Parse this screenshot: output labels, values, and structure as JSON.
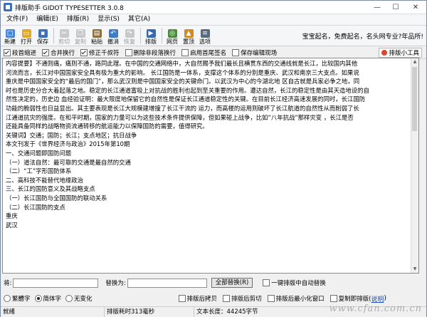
{
  "window": {
    "title": "排版助手 GIDOT TYPESETTER 3.0.8"
  },
  "menu": [
    "文件(F)",
    "编辑(E)",
    "排版(R)",
    "显示(S)",
    "其它(A)"
  ],
  "toolbar": {
    "tools": [
      {
        "label": "新建",
        "icon": "new-file-icon",
        "color": "#4a86d8",
        "glyph": "□",
        "disabled": false
      },
      {
        "label": "打开",
        "icon": "open-folder-icon",
        "color": "#e0a92b",
        "glyph": "▭",
        "disabled": false
      },
      {
        "label": "保存",
        "icon": "save-icon",
        "color": "#3f6fb8",
        "glyph": "▪",
        "disabled": false
      },
      {
        "label": "剪切",
        "icon": "cut-icon",
        "color": "#9aa5b1",
        "glyph": "✂",
        "disabled": true
      },
      {
        "label": "复制",
        "icon": "copy-icon",
        "color": "#9aa5b1",
        "glyph": "❐",
        "disabled": true
      },
      {
        "label": "粘贴",
        "icon": "paste-icon",
        "color": "#8d6f3d",
        "glyph": "▤",
        "disabled": false
      },
      {
        "label": "撤消",
        "icon": "undo-icon",
        "color": "#3e7cc7",
        "glyph": "↶",
        "disabled": false
      },
      {
        "label": "恢复",
        "icon": "redo-icon",
        "color": "#9aa5b1",
        "glyph": "↷",
        "disabled": true
      },
      {
        "label": "排版",
        "icon": "typeset-icon",
        "color": "#3b67b0",
        "glyph": "▶",
        "disabled": false
      },
      {
        "label": "网页",
        "icon": "webpage-icon",
        "color": "#4c8a3f",
        "glyph": "◎",
        "disabled": false
      },
      {
        "label": "置顶",
        "icon": "pin-top-icon",
        "color": "#d48a1e",
        "glyph": "▲",
        "disabled": false
      },
      {
        "label": "选项",
        "icon": "options-icon",
        "color": "#586a7e",
        "glyph": "≡",
        "disabled": false
      }
    ],
    "slogan": "宝宝起名，免费起名，名头网专业?年品所!"
  },
  "options": [
    {
      "label": "段首缩进",
      "checked": true
    },
    {
      "label": "合并换行",
      "checked": true
    },
    {
      "label": "修正千叔符",
      "checked": true
    },
    {
      "label": "删除非段落换行",
      "checked": false
    },
    {
      "label": "启用首尾签名",
      "checked": false
    },
    {
      "label": "保存编辑现场",
      "checked": false
    }
  ],
  "small_tools_label": "排版小工具",
  "editor": {
    "lines": [
      "  内容提要】不通则痛，痛则不通，路同此理。在中国的交通网络中，大自然赐予我们最长且横贯东西的交通线就是长江，比较国内其他",
      "河流而言，长江对中国国家安全具有极为重大的影响。  长江国防是一体系，支撑这个体系的分别是重庆、武汉和南京三大支点。如果说",
      "重庆是中国国家安全的“最后的国门”，那么武汉则是中国国家安全的关键命门。以武汉为中心的今湖北地  区自古就是兵家必争之地，同",
      "时也是历史分合大着起落之地。稳定的长江通道富吸上对抗战的胜利也起到至关重要的作用。遭达自然，长江的稳定性是由其天造地设的自",
      "然性决定的，历史边  血经验证明：最大限度地保留它的自然性是保证长江通道稳定性的关键。在目前长江经济高速发展的同时，长江国防",
      "功能的脆弱性也日益显出。其主要表现是长江大规模建增撞了长江干流的  运力，而高楼的运用则破坏了长江航道的自然性从而削弱了长",
      "江通道抗灾的强度。在和平时期，国家的力量可以为这些技术条件提供保障，但如果碰上战争，比如“八年抗战”那样灾变  ，长江是否",
      "还能具备同样的战略物资流通转移的航运能力以保障国防的需要，值得研究。",
      "  关键词】交通；国防；长江；支点地区；抗日战争",
      "  本文刊发于《世界经济与政治》2015年第10期",
      "  一、交通问题即国防问题",
      "  （一）道法自然：最可靠的交通是最自然的交通",
      "  （二）“工”字形国防体系",
      "  二、高科技不能替代地缘政治",
      "  三、长江的国防意义及其战略支点",
      "  （一）长江国防与全国国防的联动关系",
      "  （二）长江国防的支点",
      "  重庆",
      "  武汉"
    ]
  },
  "find": {
    "find_label": "将:",
    "replace_label": "替换为:",
    "replace_all_label": "全部替换(R)",
    "auto_typeset_label": "一键排版中自动替换"
  },
  "bottom_options": {
    "radios": [
      {
        "label": "繁體字",
        "selected": false
      },
      {
        "label": "简体字",
        "selected": true
      },
      {
        "label": "无变化",
        "selected": false
      }
    ],
    "checks": [
      {
        "label": "排版后拷贝",
        "checked": false
      },
      {
        "label": "排版后剪切",
        "checked": false
      },
      {
        "label": "排版后最小化窗口",
        "checked": false
      },
      {
        "label": "复制即排版(",
        "checked": false
      }
    ],
    "note_link": "说明",
    "note_close": ")"
  },
  "status": {
    "state": "就绪",
    "time": "排版耗时313毫秒",
    "length": "文本长度：44245字节"
  },
  "watermark": "www.cfan.com.cn"
}
